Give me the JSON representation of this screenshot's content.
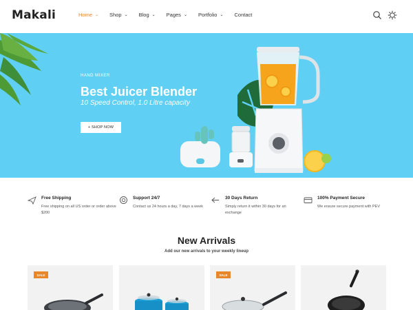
{
  "header": {
    "logo": "Makali",
    "nav": [
      {
        "label": "Home",
        "chevron": true,
        "active": true
      },
      {
        "label": "Shop",
        "chevron": true
      },
      {
        "label": "Blog",
        "chevron": true
      },
      {
        "label": "Pages",
        "chevron": true
      },
      {
        "label": "Portfolio",
        "chevron": true
      },
      {
        "label": "Contact",
        "chevron": false
      }
    ],
    "icons": [
      "search-icon",
      "gear-icon"
    ]
  },
  "hero": {
    "subtitle": "HAND MIXER",
    "title": "Best Juicer Blender",
    "description": "10 Speed Control, 1.0 Litre capacity",
    "button_label": "+ SHOP NOW",
    "background_color": "#5fd0f4"
  },
  "features": [
    {
      "icon": "plane-icon",
      "title": "Free Shipping",
      "description": "Free shipping on all US order or order above $200"
    },
    {
      "icon": "support-icon",
      "title": "Support 24/7",
      "description": "Contact us 24 hours a day, 7 days a week"
    },
    {
      "icon": "return-icon",
      "title": "30 Days Return",
      "description": "Simply return it within 30 days for an exchange"
    },
    {
      "icon": "card-icon",
      "title": "100% Payment Secure",
      "description": "We ensure secure payment with PEV"
    }
  ],
  "new_arrivals": {
    "title": "New Arrivals",
    "subtitle": "Add our new arrivals to your weekly lineup",
    "products": [
      {
        "badge": "SALE",
        "image": "frying-pan"
      },
      {
        "badge": "",
        "image": "pot-set"
      },
      {
        "badge": "SALE",
        "image": "frying-pan-with-lid"
      },
      {
        "badge": "",
        "image": "black-frying-pan"
      }
    ]
  },
  "colors": {
    "accent": "#e8862a",
    "hero": "#5fd0f4"
  }
}
